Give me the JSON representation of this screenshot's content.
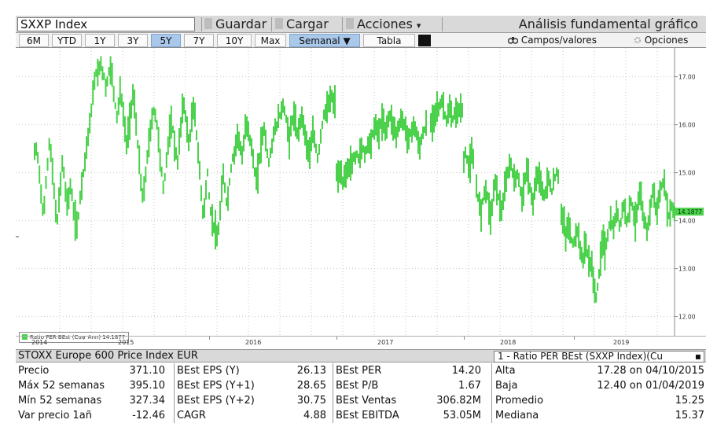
{
  "toolbar": {
    "ticker": "SXXP Index",
    "guardar": "Guardar",
    "cargar": "Cargar",
    "acciones": "Acciones",
    "acciones_arrow": "▾",
    "view_title": "Análisis fundamental gráfico"
  },
  "rangebar": {
    "ranges": [
      "6M",
      "YTD",
      "1Y",
      "3Y",
      "5Y",
      "7Y",
      "10Y",
      "Max"
    ],
    "active_range": "5Y",
    "frequency": "Semanal ▼",
    "tabla": "Tabla",
    "campos": "Campos/valores",
    "opciones": "Opciones"
  },
  "chart_data": {
    "type": "bar",
    "subtype": "hi-lo weekly bars",
    "color": "#4bd14b",
    "y_ticks": [
      "12.00",
      "13.00",
      "14.00",
      "15.00",
      "16.00",
      "17.00"
    ],
    "ylim": [
      11.6,
      17.6
    ],
    "x_labels": [
      "2014",
      "2015",
      "2016",
      "2017",
      "2018",
      "2019"
    ],
    "last_value": "14.1877",
    "legend": "Ratio PER BEst (Curr Ann) 14.1877",
    "segments": [
      {
        "x": [
          24,
          84
        ],
        "values": [
          15.4,
          15.5,
          15.3,
          15.0,
          14.6,
          14.2,
          14.3,
          14.8,
          15.2,
          15.6,
          15.4,
          15.0,
          14.6,
          14.2,
          14.0,
          14.4,
          14.8,
          15.2,
          15.0,
          14.6,
          14.4,
          14.5,
          14.7,
          14.5,
          14.2,
          14.0,
          13.9,
          14.1,
          14.5,
          14.8
        ]
      },
      {
        "x": [
          86,
          206
        ],
        "values": [
          15.0,
          15.3,
          15.5,
          15.8,
          16.0,
          16.3,
          16.6,
          16.9,
          17.1,
          17.0,
          17.2,
          17.3,
          17.1,
          17.0,
          16.8,
          16.9,
          17.1,
          17.2,
          17.0,
          16.7,
          16.4,
          16.2,
          16.4,
          16.7,
          16.5,
          16.2,
          15.9,
          15.6,
          15.8,
          16.1,
          16.4,
          16.6,
          16.4,
          16.0,
          15.6,
          15.2,
          14.8,
          14.5,
          14.6,
          15.0,
          15.3,
          15.6,
          15.9,
          16.1,
          16.3,
          16.2,
          16.0,
          15.7,
          15.3,
          15.0,
          14.7,
          14.9,
          15.3,
          15.6,
          15.8,
          16.0,
          15.9,
          15.6,
          15.4,
          15.2
        ]
      },
      {
        "x": [
          208,
          244
        ],
        "values": [
          15.6,
          16.0,
          16.3,
          16.4,
          16.2,
          15.9,
          15.6,
          15.8,
          16.1,
          16.3,
          16.2,
          15.8,
          15.4,
          15.0,
          14.6,
          14.2,
          14.3,
          14.6,
          15.0
        ]
      },
      {
        "x": [
          246,
          406
        ],
        "values": [
          14.5,
          14.2,
          14.0,
          13.9,
          13.8,
          13.6,
          13.8,
          14.2,
          14.6,
          14.9,
          14.7,
          14.4,
          14.5,
          14.8,
          15.1,
          15.3,
          15.4,
          15.6,
          15.8,
          15.7,
          15.5,
          15.3,
          15.6,
          15.9,
          16.0,
          15.9,
          15.7,
          15.5,
          15.3,
          15.0,
          14.8,
          15.0,
          15.3,
          15.6,
          15.8,
          15.9,
          15.7,
          15.4,
          15.2,
          15.4,
          15.6,
          15.8,
          15.9,
          16.0,
          16.1,
          16.2,
          16.3,
          16.4,
          16.3,
          16.1,
          15.9,
          15.7,
          15.9,
          16.1,
          16.2,
          16.0,
          15.8,
          15.9,
          16.1,
          16.2,
          16.0,
          15.8,
          15.6,
          15.5,
          15.4,
          15.6,
          15.8,
          15.7,
          15.5,
          15.3,
          15.5,
          15.8,
          16.0,
          16.2,
          16.3,
          16.3,
          16.4,
          16.5,
          16.6,
          16.4,
          16.5
        ]
      },
      {
        "x": [
          408,
          454
        ],
        "values": [
          15.0,
          14.9,
          15.0,
          14.9,
          14.8,
          14.9,
          15.0,
          15.1,
          15.1,
          15.2,
          15.2,
          15.3,
          15.3,
          15.4,
          15.3,
          15.4,
          15.5,
          15.5,
          15.4,
          15.5,
          15.6,
          15.6,
          15.7,
          15.8
        ]
      },
      {
        "x": [
          456,
          522
        ],
        "values": [
          15.9,
          16.0,
          15.9,
          15.8,
          16.0,
          16.1,
          16.0,
          15.9,
          16.0,
          16.1,
          16.2,
          16.1,
          16.0,
          15.9,
          15.8,
          15.9,
          16.0,
          16.1,
          16.1,
          16.0,
          15.9,
          15.8,
          15.7,
          15.8,
          15.9,
          16.0,
          15.9,
          15.8,
          15.6,
          15.5,
          15.7,
          15.8,
          15.9,
          16.0
        ]
      },
      {
        "x": [
          528,
          568
        ],
        "values": [
          16.0,
          16.1,
          16.2,
          16.3,
          16.4,
          16.3,
          16.4,
          16.5,
          16.4,
          16.2,
          16.1,
          16.2,
          16.3,
          16.2,
          16.1,
          16.2,
          16.3,
          16.2,
          16.3,
          16.4,
          16.3
        ]
      },
      {
        "x": [
          570,
          582
        ],
        "values": [
          15.2,
          15.4,
          15.3,
          15.1,
          15.2,
          15.4,
          15.2
        ]
      },
      {
        "x": [
          586,
          690
        ],
        "values": [
          14.7,
          14.5,
          14.3,
          14.2,
          14.4,
          14.6,
          14.7,
          14.5,
          14.3,
          14.1,
          14.3,
          14.6,
          14.8,
          14.7,
          14.5,
          14.3,
          14.2,
          14.4,
          14.6,
          14.8,
          15.0,
          15.1,
          15.2,
          15.0,
          14.8,
          14.9,
          15.0,
          14.8,
          14.6,
          14.5,
          14.7,
          14.9,
          15.0,
          14.9,
          14.7,
          14.5,
          14.4,
          14.6,
          14.8,
          14.9,
          15.0,
          14.8,
          14.6,
          14.5,
          14.6,
          14.8,
          14.9,
          14.7,
          14.6,
          14.8,
          14.9,
          15.0,
          14.9
        ]
      },
      {
        "x": [
          694,
          838
        ],
        "values": [
          14.2,
          14.0,
          13.9,
          13.7,
          13.8,
          13.9,
          13.8,
          13.6,
          13.5,
          13.6,
          13.7,
          13.8,
          13.6,
          13.4,
          13.3,
          13.2,
          13.4,
          13.5,
          13.3,
          13.2,
          13.1,
          13.0,
          12.8,
          12.6,
          12.4,
          12.6,
          12.9,
          13.2,
          13.5,
          13.6,
          13.4,
          13.5,
          13.7,
          13.9,
          14.0,
          13.9,
          13.8,
          14.0,
          14.2,
          14.1,
          13.9,
          14.0,
          14.2,
          14.3,
          14.2,
          14.0,
          14.1,
          14.3,
          14.4,
          14.3,
          14.1,
          14.0,
          14.2,
          14.4,
          14.5,
          14.4,
          14.2,
          14.0,
          13.9,
          13.8,
          14.0,
          14.2,
          14.4,
          14.6,
          14.5,
          14.3,
          14.2,
          14.4,
          14.6,
          14.7,
          14.8,
          14.7,
          14.5,
          14.3,
          14.1,
          14.2,
          14.3,
          14.2,
          14.19
        ]
      }
    ]
  },
  "info": {
    "title": "STOXX Europe 600 Price Index EUR",
    "select": "1 - Ratio PER BEst (SXXP Index)(Cu",
    "select_arrow": "▪"
  },
  "stats": {
    "col1": [
      {
        "label": "Precio",
        "value": "371.10"
      },
      {
        "label": "Máx 52 semanas",
        "value": "395.10"
      },
      {
        "label": "Mín 52 semanas",
        "value": "327.34"
      },
      {
        "label": "Var precio 1añ",
        "value": "-12.46"
      }
    ],
    "col2": [
      {
        "label": "BEst EPS (Y)",
        "value": "26.13"
      },
      {
        "label": "BEst EPS (Y+1)",
        "value": "28.65"
      },
      {
        "label": "BEst EPS (Y+2)",
        "value": "30.75"
      },
      {
        "label": "CAGR",
        "value": "4.88"
      }
    ],
    "col3": [
      {
        "label": "BEst PER",
        "value": "14.20"
      },
      {
        "label": "BEst P/B",
        "value": "1.67"
      },
      {
        "label": "BEst Ventas",
        "value": "306.82M"
      },
      {
        "label": "BEst EBITDA",
        "value": "53.05M"
      }
    ],
    "col4": [
      {
        "label": "Alta",
        "value": "17.28 on 04/10/2015"
      },
      {
        "label": "Baja",
        "value": "12.40 on 01/04/2019"
      },
      {
        "label": "Promedio",
        "value": "15.25"
      },
      {
        "label": "Mediana",
        "value": "15.37"
      }
    ]
  }
}
